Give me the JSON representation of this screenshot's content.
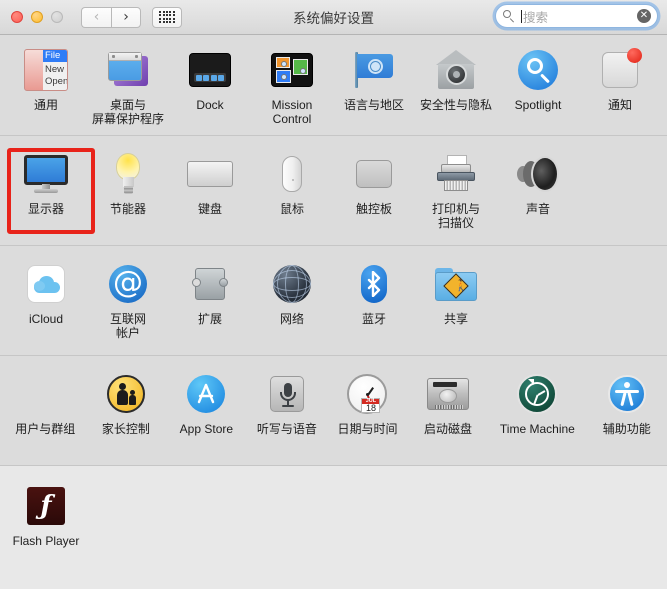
{
  "window": {
    "title": "系统偏好设置",
    "traffic_lights": [
      "close",
      "minimize",
      "zoom"
    ],
    "nav": {
      "back_label": "‹",
      "forward_label": "›"
    },
    "grid_button": "show-all-grid"
  },
  "search": {
    "placeholder": "搜索",
    "value": "",
    "clear_label": "✕"
  },
  "highlight": {
    "target": "显示器",
    "color": "#e8231a"
  },
  "rows": [
    {
      "name": "personal",
      "items": [
        {
          "label": "通用",
          "icon": "general-icon",
          "general": {
            "menu_title": "File",
            "item1": "New",
            "item2": "Open"
          }
        },
        {
          "label": "桌面与\n屏幕保护程序",
          "icon": "desktop-screensaver-icon"
        },
        {
          "label": "Dock",
          "icon": "dock-icon"
        },
        {
          "label": "Mission\nControl",
          "icon": "mission-control-icon"
        },
        {
          "label": "语言与地区",
          "icon": "language-region-icon"
        },
        {
          "label": "安全性与隐私",
          "icon": "security-privacy-icon"
        },
        {
          "label": "Spotlight",
          "icon": "spotlight-icon"
        },
        {
          "label": "通知",
          "icon": "notifications-icon"
        }
      ]
    },
    {
      "name": "hardware",
      "items": [
        {
          "label": "显示器",
          "icon": "displays-icon",
          "highlighted": true
        },
        {
          "label": "节能器",
          "icon": "energy-saver-icon"
        },
        {
          "label": "键盘",
          "icon": "keyboard-icon"
        },
        {
          "label": "鼠标",
          "icon": "mouse-icon"
        },
        {
          "label": "触控板",
          "icon": "trackpad-icon"
        },
        {
          "label": "打印机与\n扫描仪",
          "icon": "printers-scanners-icon"
        },
        {
          "label": "声音",
          "icon": "sound-icon"
        }
      ]
    },
    {
      "name": "internet-wireless",
      "items": [
        {
          "label": "iCloud",
          "icon": "icloud-icon"
        },
        {
          "label": "互联网\n帐户",
          "icon": "internet-accounts-icon"
        },
        {
          "label": "扩展",
          "icon": "extensions-icon"
        },
        {
          "label": "网络",
          "icon": "network-icon"
        },
        {
          "label": "蓝牙",
          "icon": "bluetooth-icon"
        },
        {
          "label": "共享",
          "icon": "sharing-icon"
        }
      ]
    },
    {
      "name": "system",
      "items": [
        {
          "label": "用户与群组",
          "icon": "users-groups-icon"
        },
        {
          "label": "家长控制",
          "icon": "parental-controls-icon"
        },
        {
          "label": "App Store",
          "icon": "app-store-icon"
        },
        {
          "label": "听写与语音",
          "icon": "dictation-speech-icon"
        },
        {
          "label": "日期与时间",
          "icon": "date-time-icon",
          "clock": {
            "month": "JUL",
            "day": "18"
          }
        },
        {
          "label": "启动磁盘",
          "icon": "startup-disk-icon"
        },
        {
          "label": "Time Machine",
          "icon": "time-machine-icon"
        },
        {
          "label": "辅助功能",
          "icon": "accessibility-icon"
        }
      ]
    },
    {
      "name": "third-party",
      "items": [
        {
          "label": "Flash Player",
          "icon": "flash-player-icon",
          "flash_glyph": "ƒ"
        }
      ]
    }
  ]
}
